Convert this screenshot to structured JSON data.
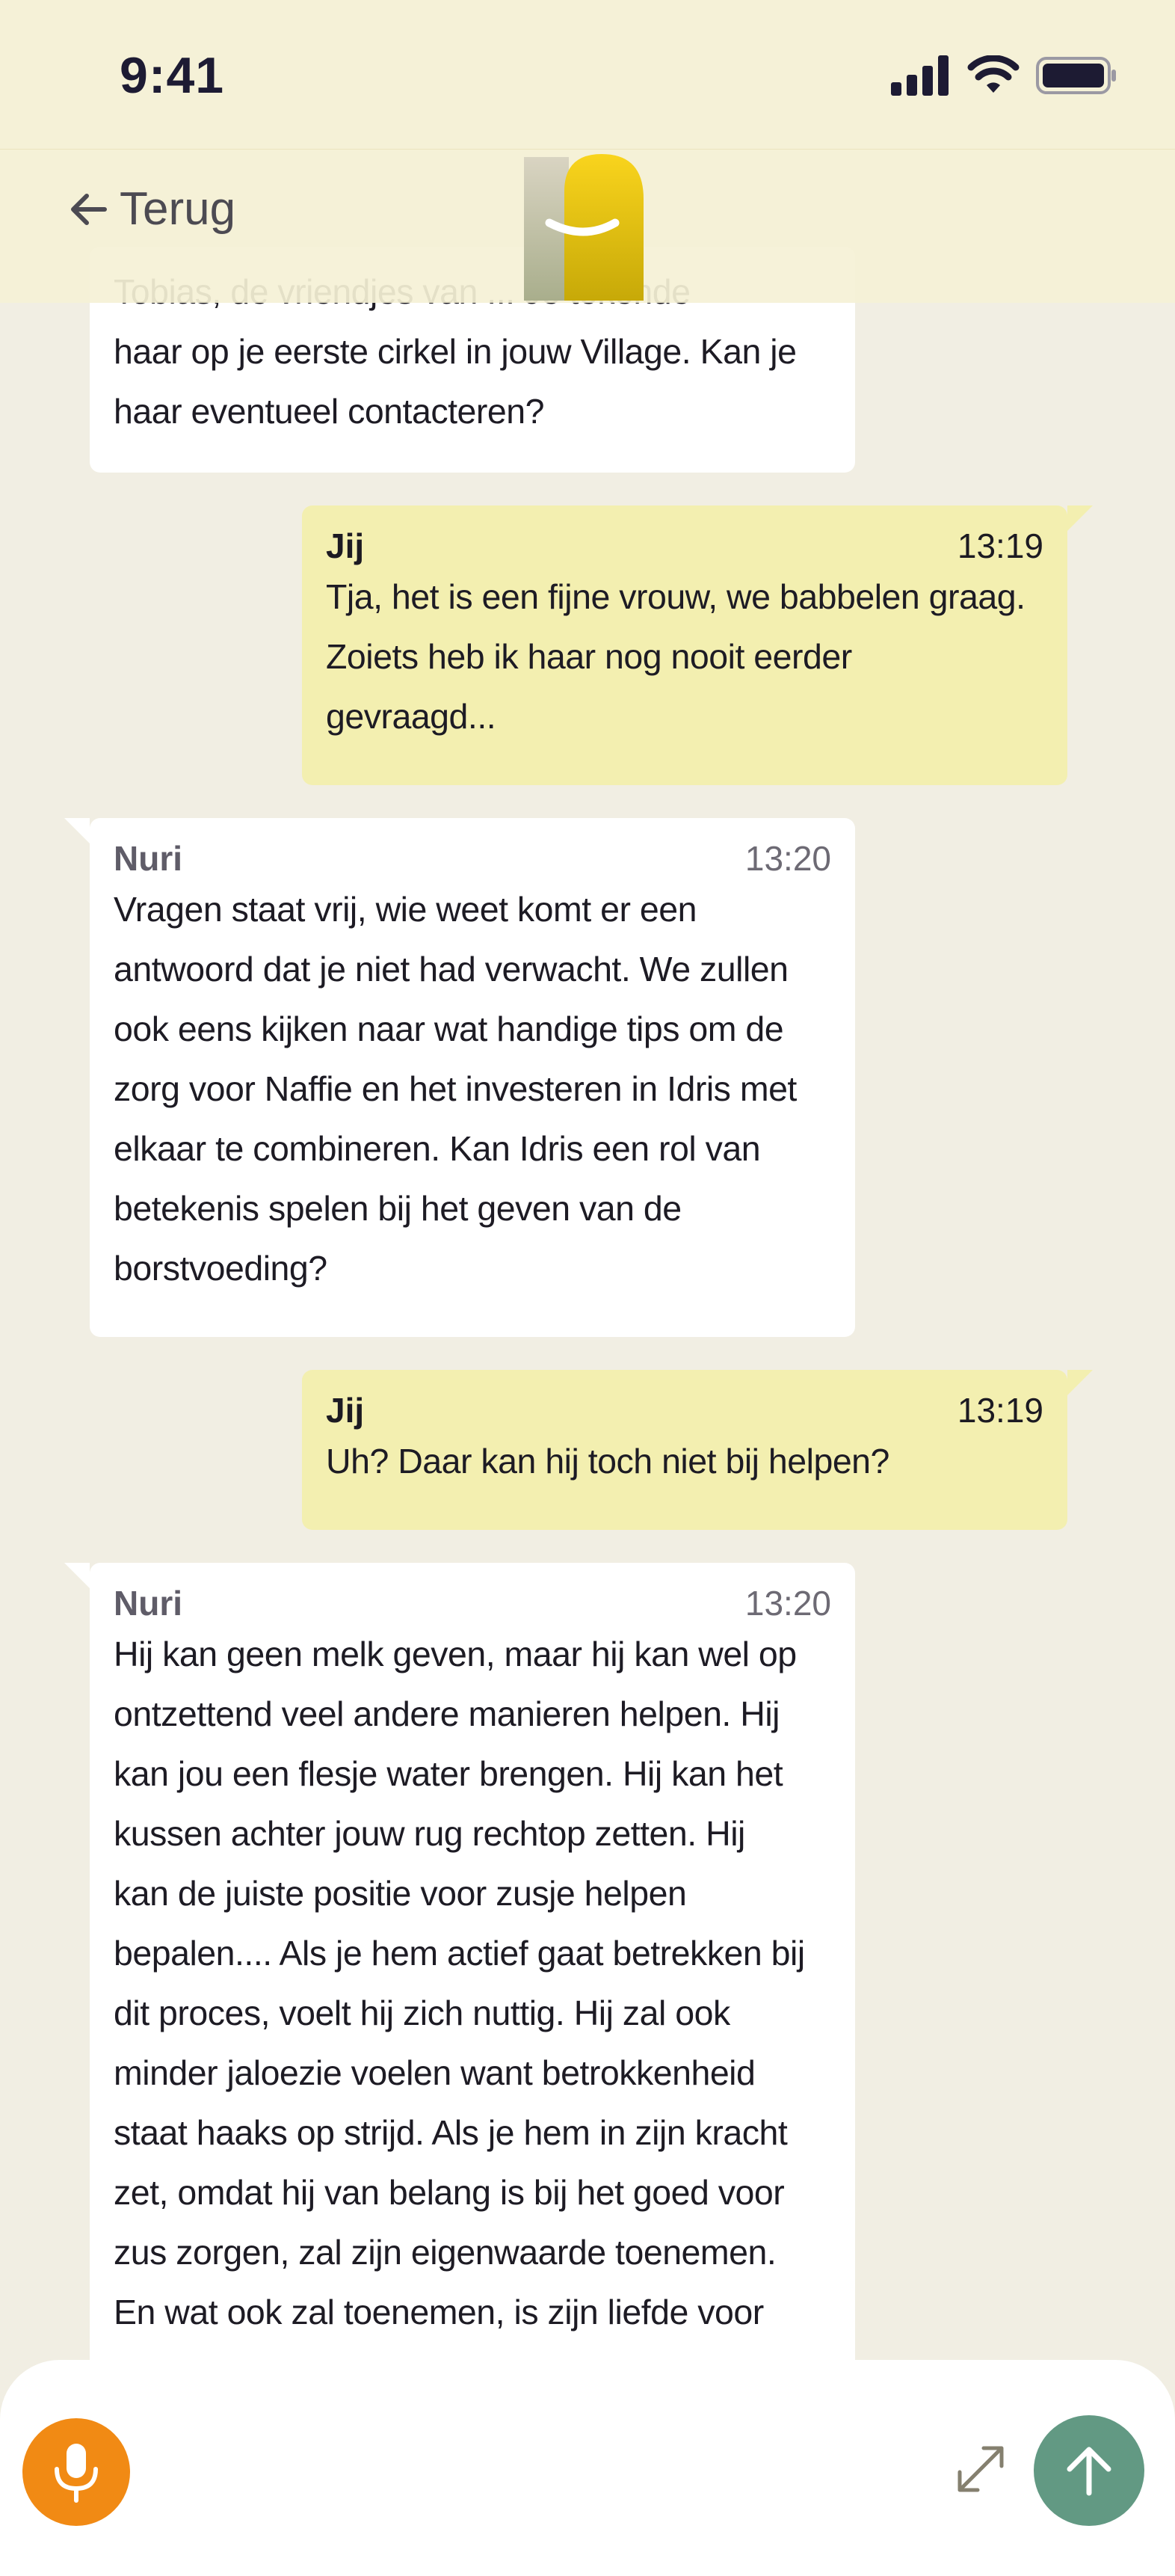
{
  "status_bar": {
    "time": "9:41"
  },
  "nav": {
    "back_label": "Terug"
  },
  "messages": [
    {
      "role": "them",
      "sender": "",
      "time": "",
      "lines": [
        "Tobias, de vriendjes van ... Je tekende",
        "haar op je eerste cirkel in jouw Village. Kan je",
        "haar eventueel contacteren?"
      ]
    },
    {
      "role": "me",
      "sender": "Jij",
      "time": "13:19",
      "lines": [
        "Tja, het is een fijne vrouw, we babbelen graag.",
        "Zoiets heb ik haar nog nooit eerder",
        "gevraagd..."
      ]
    },
    {
      "role": "them",
      "sender": "Nuri",
      "time": "13:20",
      "lines": [
        "Vragen staat vrij, wie weet komt er een",
        "antwoord dat je niet had verwacht. We zullen",
        "ook eens kijken naar wat handige tips om de",
        "zorg voor Naffie en het investeren in Idris met",
        "elkaar te combineren. Kan Idris een rol van",
        "betekenis spelen bij het geven van de",
        "borstvoeding?"
      ]
    },
    {
      "role": "me",
      "sender": "Jij",
      "time": "13:19",
      "lines": [
        "Uh? Daar kan hij toch niet bij helpen?"
      ]
    },
    {
      "role": "them",
      "sender": "Nuri",
      "time": "13:20",
      "lines": [
        "Hij kan geen melk geven, maar hij kan wel op",
        "ontzettend veel andere manieren helpen. Hij",
        "kan jou een flesje water brengen. Hij kan het",
        "kussen achter jouw rug rechtop zetten. Hij",
        "kan de juiste positie voor zusje helpen",
        "bepalen.... Als je hem actief gaat betrekken bij",
        "dit proces, voelt hij zich nuttig. Hij zal ook",
        "minder jaloezie voelen want betrokkenheid",
        "staat haaks op strijd. Als je hem in zijn kracht",
        "zet, omdat hij van belang is bij het goed voor",
        "zus zorgen, zal zijn eigenwaarde toenemen.",
        "En wat ook zal toenemen, is zijn liefde voor"
      ]
    }
  ],
  "composer": {
    "mic_icon": "microphone-icon",
    "expand_icon": "expand-icon",
    "send_icon": "arrow-up-icon"
  },
  "colors": {
    "background": "#f1eee3",
    "own_bubble": "#f3efb0",
    "other_bubble": "#ffffff",
    "mic_button": "#f18a14",
    "send_button": "#629983"
  }
}
